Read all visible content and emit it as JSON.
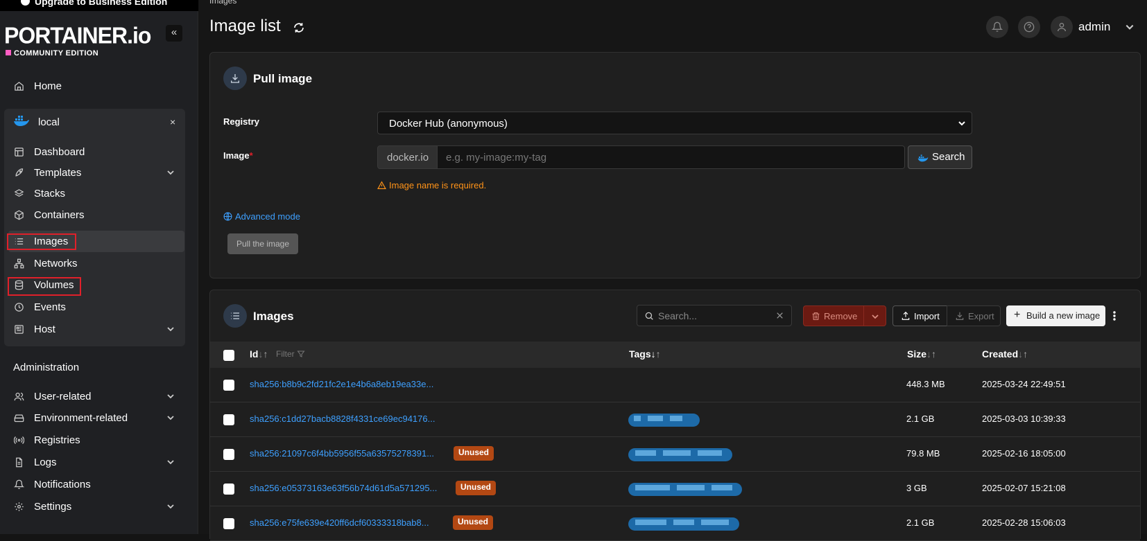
{
  "sidebar": {
    "upgrade_label": "Upgrade to Business Edition",
    "logo_text": "PORTAINER.io",
    "edition": "COMMUNITY EDITION",
    "collapse_label": "«",
    "home_label": "Home",
    "env_name": "local",
    "env_close": "×",
    "env_items": [
      {
        "label": "Dashboard",
        "icon": "dashboard-icon"
      },
      {
        "label": "Templates",
        "icon": "rocket-icon"
      },
      {
        "label": "Stacks",
        "icon": "layers-icon"
      },
      {
        "label": "Containers",
        "icon": "box-icon"
      },
      {
        "label": "Images",
        "icon": "list-icon"
      },
      {
        "label": "Networks",
        "icon": "network-icon"
      },
      {
        "label": "Volumes",
        "icon": "database-icon"
      },
      {
        "label": "Events",
        "icon": "clock-icon"
      },
      {
        "label": "Host",
        "icon": "host-icon"
      }
    ],
    "admin_heading": "Administration",
    "admin_items": [
      {
        "label": "User-related",
        "icon": "users-icon"
      },
      {
        "label": "Environment-related",
        "icon": "hard-drive-icon"
      },
      {
        "label": "Registries",
        "icon": "radio-icon"
      },
      {
        "label": "Logs",
        "icon": "file-icon"
      },
      {
        "label": "Notifications",
        "icon": "bell-icon"
      },
      {
        "label": "Settings",
        "icon": "gear-icon"
      }
    ]
  },
  "header": {
    "breadcrumb": "Images",
    "title": "Image list",
    "user": "admin"
  },
  "pull": {
    "title": "Pull image",
    "registry_label": "Registry",
    "registry_value": "Docker Hub (anonymous)",
    "image_label": "Image",
    "required_mark": "*",
    "prefix": "docker.io",
    "placeholder": "e.g. my-image:my-tag",
    "search_label": "Search",
    "warning": "Image name is required.",
    "advanced_label": "Advanced mode",
    "pull_button": "Pull the image"
  },
  "images": {
    "title": "Images",
    "search_placeholder": "Search...",
    "remove_label": "Remove",
    "import_label": "Import",
    "export_label": "Export",
    "build_label": "Build a new image",
    "columns": {
      "id": "Id",
      "filter": "Filter",
      "tags": "Tags",
      "size": "Size",
      "created": "Created"
    },
    "unused_label": "Unused",
    "rows": [
      {
        "id": "sha256:b8b9c2fd21fc2e1e4b6a8eb19ea33e...",
        "unused": false,
        "size": "448.3 MB",
        "created": "2025-03-24 22:49:51"
      },
      {
        "id": "sha256:c1dd27bacb8828f4331ce69ec94176...",
        "unused": false,
        "size": "2.1 GB",
        "created": "2025-03-03 10:39:33"
      },
      {
        "id": "sha256:21097c6f4bb5956f55a63575278391...",
        "unused": true,
        "size": "79.8 MB",
        "created": "2025-02-16 18:05:00"
      },
      {
        "id": "sha256:e05373163e63f56b74d61d5a571295...",
        "unused": true,
        "size": "3 GB",
        "created": "2025-02-07 15:21:08"
      },
      {
        "id": "sha256:e75fe639e420ff6dcf60333318bab8...",
        "unused": true,
        "size": "2.1 GB",
        "created": "2025-02-28 15:06:03"
      }
    ]
  },
  "colors": {
    "accent": "#3ea0ff",
    "danger": "#e0202a",
    "warning": "#ff9318",
    "unused": "#b34813"
  }
}
